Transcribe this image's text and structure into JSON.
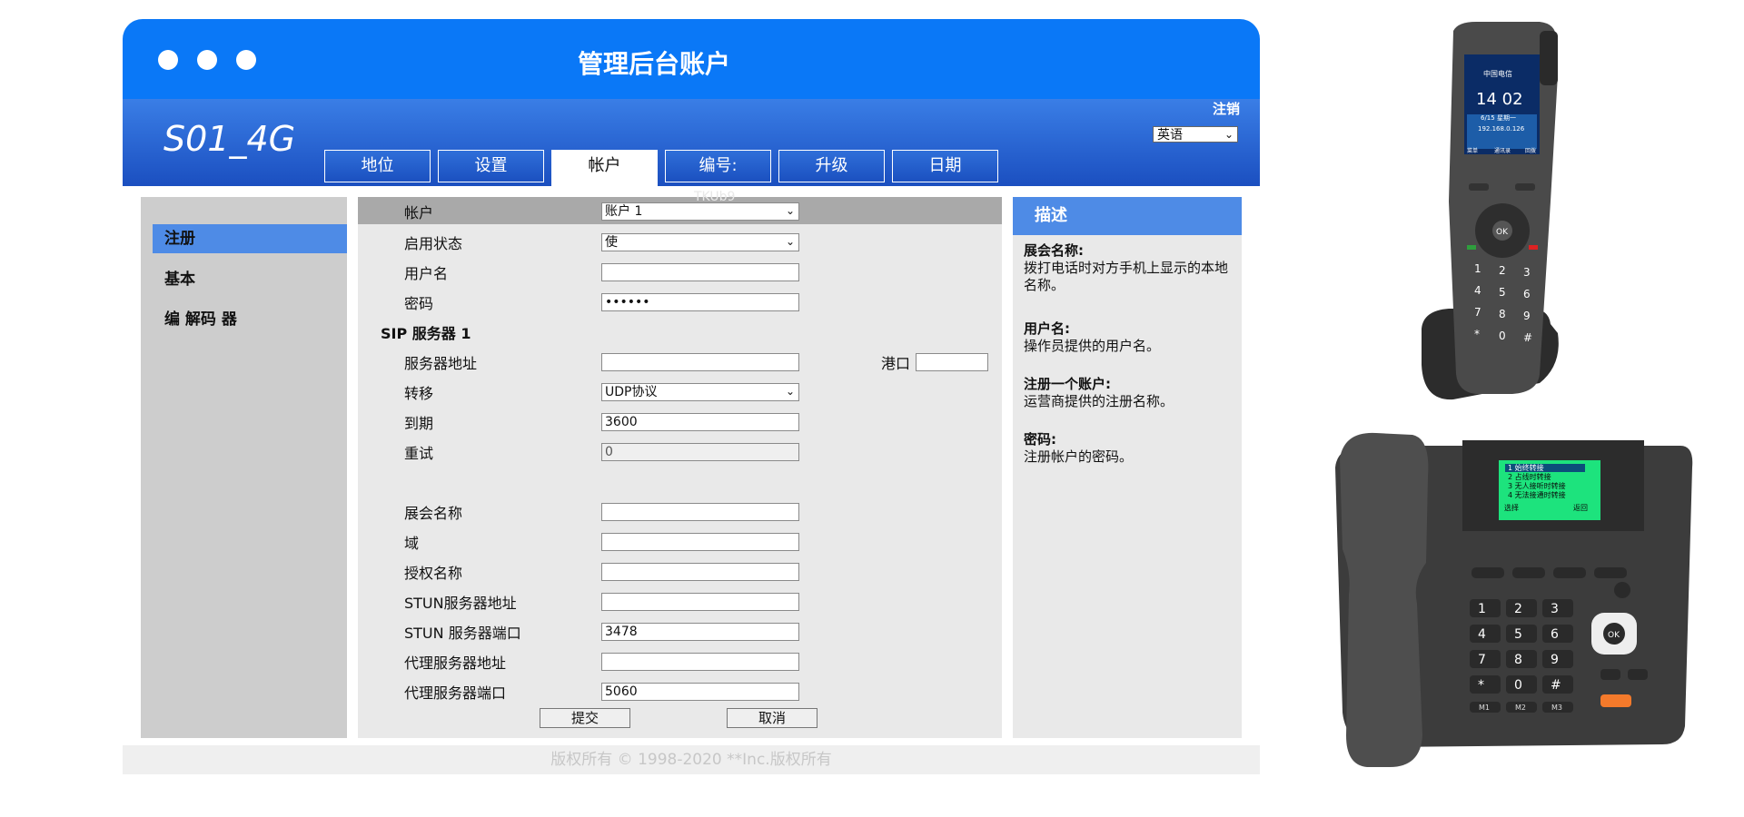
{
  "window": {
    "title": "管理后台账户",
    "product_name": "S01_4G",
    "logout": "注销",
    "language": "英语",
    "tabs": [
      "地位",
      "设置",
      "帐户",
      "编号:",
      "升级",
      "日期"
    ],
    "active_tab": "帐户",
    "watermark": "TKUb9"
  },
  "sidebar": {
    "items": [
      "注册",
      "基本",
      "编 解码 器"
    ],
    "active": "注册"
  },
  "form": {
    "account_label": "帐户",
    "account_value": "账户 1",
    "enable_label": "启用状态",
    "enable_value": "使",
    "username_label": "用户名",
    "username_value": "",
    "password_label": "密码",
    "password_value": "••••••",
    "sip_section": "SIP 服务器 1",
    "server_addr_label": "服务器地址",
    "server_addr_value": "",
    "port_label": "港口",
    "port_value": "",
    "transport_label": "转移",
    "transport_value": "UDP协议",
    "expire_label": "到期",
    "expire_value": "3600",
    "retry_label": "重试",
    "retry_value": "0",
    "display_name_label": "展会名称",
    "display_name_value": "",
    "domain_label": "域",
    "domain_value": "",
    "auth_name_label": "授权名称",
    "auth_name_value": "",
    "stun_addr_label": "STUN服务器地址",
    "stun_addr_value": "",
    "stun_port_label": "STUN 服务器端口",
    "stun_port_value": "3478",
    "proxy_addr_label": "代理服务器地址",
    "proxy_addr_value": "",
    "proxy_port_label": "代理服务器端口",
    "proxy_port_value": "5060",
    "submit": "提交",
    "cancel": "取消"
  },
  "description": {
    "header": "描述",
    "items": [
      {
        "title": "展会名称:",
        "text": "拨打电话时对方手机上显示的本地名称。"
      },
      {
        "title": "用户名:",
        "text": "操作员提供的用户名。"
      },
      {
        "title": "注册一个账户:",
        "text": "运营商提供的注册名称。"
      },
      {
        "title": "密码:",
        "text": "注册帐户的密码。"
      }
    ]
  },
  "footer": "版权所有 © 1998-2020 **Inc.版权所有",
  "handset": {
    "status": "中国电信",
    "time": "14 02",
    "date": "6/15 星期一",
    "ip": "192.168.0.126",
    "softkeys": [
      "菜单",
      "通讯录",
      "回拨"
    ],
    "ok": "OK",
    "keys": [
      "1",
      "2",
      "3",
      "4",
      "5",
      "6",
      "7",
      "8",
      "9",
      "*",
      "0",
      "#"
    ]
  },
  "desk_phone": {
    "screen_lines": [
      "1 始终转接",
      "2 占线时转接",
      "3 无人接听时转接",
      "4 无法接通时转接"
    ],
    "screen_left": "选择",
    "screen_right": "返回",
    "ok": "OK",
    "keys": [
      "1",
      "2",
      "3",
      "4",
      "5",
      "6",
      "7",
      "8",
      "9",
      "*",
      "0",
      "#"
    ],
    "mem_keys": [
      "M1",
      "M2",
      "M3"
    ]
  },
  "colors": {
    "titlebar": "#0a78f7",
    "banner": "#1b4fc0",
    "nav_active": "#4e8be6",
    "panel": "#e9e9e9",
    "sidebar": "#cdcdcd"
  }
}
